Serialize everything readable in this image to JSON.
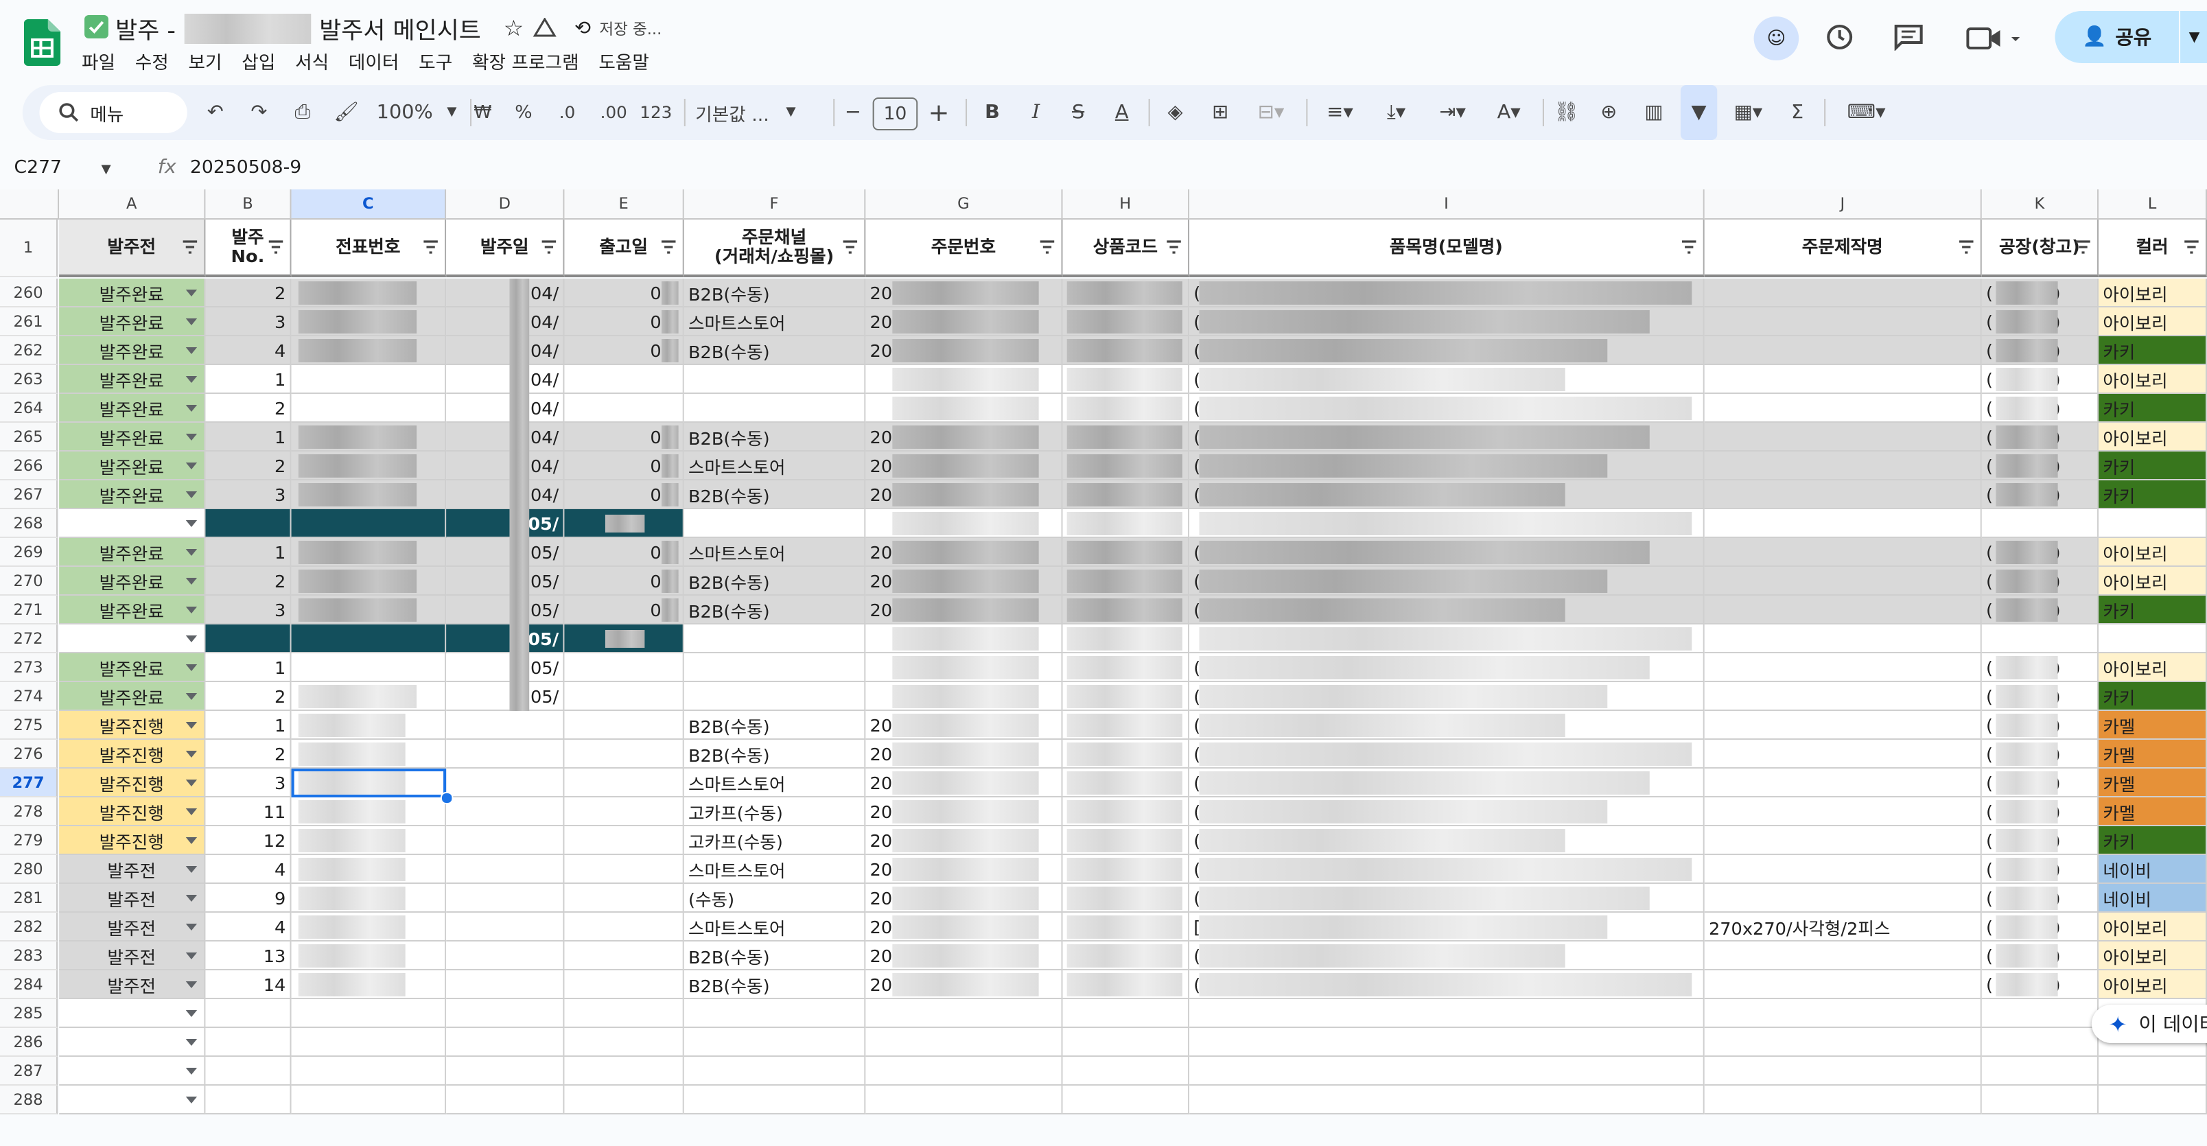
{
  "app": {
    "title_prefix": "발주 -",
    "title_suffix": "발주서 메인시트",
    "save_status": "저장 중...",
    "menus": [
      "파일",
      "수정",
      "보기",
      "삽입",
      "서식",
      "데이터",
      "도구",
      "확장 프로그램",
      "도움말"
    ],
    "share_label": "공유"
  },
  "toolbar": {
    "search_label": "메뉴",
    "zoom": "100%",
    "currency": "₩",
    "percent": "%",
    "dec_decrease": ".0",
    "dec_increase": ".00",
    "number_format": "123",
    "font_name": "기본값 ...",
    "font_size": "10",
    "bold": "B",
    "italic": "I",
    "strike": "S",
    "text_color": "A",
    "sum": "Σ"
  },
  "formula_bar": {
    "name_box": "C277",
    "fx": "fx",
    "value": "20250508-9"
  },
  "columns": [
    "A",
    "B",
    "C",
    "D",
    "E",
    "F",
    "G",
    "H",
    "I",
    "J",
    "K",
    "L"
  ],
  "headers": {
    "A": "발주전",
    "B1": "발주",
    "B2": "No.",
    "C": "전표번호",
    "D": "발주일",
    "E": "출고일",
    "F1": "주문채널",
    "F2": "(거래처/쇼핑몰)",
    "G": "주문번호",
    "H": "상품코드",
    "I": "품목명(모델명)",
    "J": "주문제작명",
    "K": "공장(창고)",
    "L": "컬러"
  },
  "header_row_num": "1",
  "rows": [
    {
      "n": "260",
      "status": "발주완료",
      "no": "2",
      "d": "04/",
      "e": "04/",
      "f": "B2B(수동)",
      "g": "20",
      "i": "(",
      "k": "(",
      "k2": ")",
      "color": "아이보리"
    },
    {
      "n": "261",
      "status": "발주완료",
      "no": "3",
      "d": "04/",
      "e": "04/",
      "f": "스마트스토어",
      "g": "20",
      "i": "(",
      "k": "(",
      "k2": ")",
      "color": "아이보리"
    },
    {
      "n": "262",
      "status": "발주완료",
      "no": "4",
      "d": "04/",
      "e": "04/",
      "f": "B2B(수동)",
      "g": "20",
      "i": "(",
      "k": "(",
      "k2": ")",
      "color": "카키"
    },
    {
      "n": "263",
      "status": "발주완료",
      "no": "1",
      "d": "04/",
      "e": "",
      "f": "",
      "g": "",
      "i": "(",
      "k": "(",
      "k2": ")",
      "color": "아이보리"
    },
    {
      "n": "264",
      "status": "발주완료",
      "no": "2",
      "d": "04/",
      "e": "",
      "f": "",
      "g": "",
      "i": "(",
      "k": "(",
      "k2": ")",
      "color": "카키"
    },
    {
      "n": "265",
      "status": "발주완료",
      "no": "1",
      "d": "04/",
      "e": "05/",
      "f": "B2B(수동)",
      "g": "20",
      "i": "(",
      "k": "(",
      "k2": ")",
      "color": "아이보리"
    },
    {
      "n": "266",
      "status": "발주완료",
      "no": "2",
      "d": "04/",
      "e": "05/",
      "f": "스마트스토어",
      "g": "20",
      "i": "(",
      "k": "(",
      "k2": ")",
      "color": "카키"
    },
    {
      "n": "267",
      "status": "발주완료",
      "no": "3",
      "d": "04/",
      "e": "05/",
      "f": "B2B(수동)",
      "g": "20",
      "i": "(",
      "k": "(",
      "k2": ")",
      "color": "카키"
    },
    {
      "n": "268",
      "status": "",
      "no": "",
      "d": "05/",
      "e": "",
      "f": "",
      "g": "",
      "i": "",
      "k": "",
      "k2": "",
      "color": ""
    },
    {
      "n": "269",
      "status": "발주완료",
      "no": "1",
      "d": "05/",
      "e": "05/",
      "f": "스마트스토어",
      "g": "20",
      "i": "(",
      "k": "(",
      "k2": ")",
      "color": "아이보리"
    },
    {
      "n": "270",
      "status": "발주완료",
      "no": "2",
      "d": "05/",
      "e": "05/",
      "f": "B2B(수동)",
      "g": "20",
      "i": "(",
      "k": "(",
      "k2": ")",
      "color": "아이보리"
    },
    {
      "n": "271",
      "status": "발주완료",
      "no": "3",
      "d": "05/",
      "e": "05/",
      "f": "B2B(수동)",
      "g": "20",
      "i": "(",
      "k": "(",
      "k2": ")",
      "color": "카키"
    },
    {
      "n": "272",
      "status": "",
      "no": "",
      "d": "05/",
      "e": "",
      "f": "",
      "g": "",
      "i": "",
      "k": "",
      "k2": "",
      "color": ""
    },
    {
      "n": "273",
      "status": "발주완료",
      "no": "1",
      "d": "05/",
      "e": "",
      "f": "",
      "g": "",
      "i": "(",
      "k": "(",
      "k2": ")",
      "color": "아이보리"
    },
    {
      "n": "274",
      "status": "발주완료",
      "no": "2",
      "d": "05/",
      "e": "",
      "f": "",
      "g": "",
      "i": "(",
      "k": "(",
      "k2": ")",
      "color": "카키"
    },
    {
      "n": "275",
      "status": "발주진행",
      "no": "1",
      "d": "",
      "e": "",
      "f": "B2B(수동)",
      "g": "20",
      "i": "(",
      "k": "(",
      "k2": ")",
      "color": "카멜"
    },
    {
      "n": "276",
      "status": "발주진행",
      "no": "2",
      "d": "",
      "e": "",
      "f": "B2B(수동)",
      "g": "20",
      "i": "(",
      "k": "(",
      "k2": ")",
      "color": "카멜"
    },
    {
      "n": "277",
      "status": "발주진행",
      "no": "3",
      "d": "",
      "e": "",
      "f": "스마트스토어",
      "g": "20",
      "i": "(",
      "k": "(",
      "k2": ")",
      "color": "카멜"
    },
    {
      "n": "278",
      "status": "발주진행",
      "no": "11",
      "d": "",
      "e": "",
      "f": "고카프(수동)",
      "g": "20",
      "i": "(",
      "k": "(",
      "k2": ")",
      "color": "카멜"
    },
    {
      "n": "279",
      "status": "발주진행",
      "no": "12",
      "d": "",
      "e": "",
      "f": "고카프(수동)",
      "g": "20",
      "i": "(",
      "k": "(",
      "k2": ")",
      "color": "카키"
    },
    {
      "n": "280",
      "status": "발주전",
      "no": "4",
      "d": "",
      "e": "",
      "f": "스마트스토어",
      "g": "20",
      "i": "(",
      "k": "(",
      "k2": ")",
      "color": "네이비"
    },
    {
      "n": "281",
      "status": "발주전",
      "no": "9",
      "d": "",
      "e": "",
      "f": "(수동)",
      "g": "20",
      "i": "(",
      "k": "(",
      "k2": ")",
      "color": "네이비"
    },
    {
      "n": "282",
      "status": "발주전",
      "no": "4",
      "d": "",
      "e": "",
      "f": "스마트스토어",
      "g": "20",
      "i": "[",
      "j": "270x270/사각형/2피스",
      "k": "(",
      "k2": ")",
      "color": "아이보리"
    },
    {
      "n": "283",
      "status": "발주전",
      "no": "13",
      "d": "",
      "e": "",
      "f": "B2B(수동)",
      "g": "20",
      "i": "(",
      "k": "(",
      "k2": ")",
      "color": "아이보리"
    },
    {
      "n": "284",
      "status": "발주전",
      "no": "14",
      "d": "",
      "e": "",
      "f": "B2B(수동)",
      "g": "20",
      "i": "(",
      "k": "(",
      "k2": ")",
      "color": "아이보리"
    },
    {
      "n": "285",
      "status": "",
      "no": "",
      "d": "",
      "e": "",
      "f": "",
      "g": "",
      "i": "",
      "k": "",
      "k2": "",
      "color": ""
    },
    {
      "n": "286",
      "status": "",
      "no": "",
      "d": "",
      "e": "",
      "f": "",
      "g": "",
      "i": "",
      "k": "",
      "k2": "",
      "color": ""
    },
    {
      "n": "287",
      "status": "",
      "no": "",
      "d": "",
      "e": "",
      "f": "",
      "g": "",
      "i": "",
      "k": "",
      "k2": "",
      "color": ""
    },
    {
      "n": "288",
      "status": "",
      "no": "",
      "d": "",
      "e": "",
      "f": "",
      "g": "",
      "i": "",
      "k": "",
      "k2": "",
      "color": ""
    }
  ],
  "gemini_label": "이 데이터",
  "colors": {
    "status_done": "#b6d7a8",
    "status_progress": "#ffe599",
    "status_before": "#d9d9d9",
    "divider_row": "#134f5c",
    "ivory": "#fff2cc",
    "khaki": "#38761d",
    "camel": "#e69138",
    "navy": "#9fc5e8",
    "row_gray": "#d9d9d9"
  }
}
